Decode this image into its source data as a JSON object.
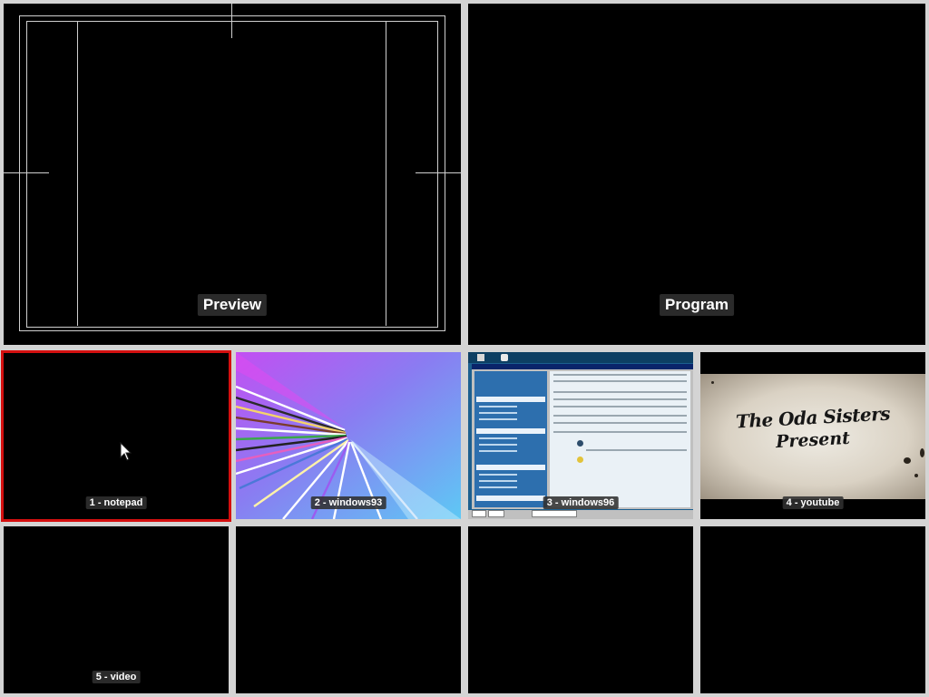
{
  "preview": {
    "label": "Preview"
  },
  "program": {
    "label": "Program"
  },
  "sources": [
    {
      "label": "1 - notepad"
    },
    {
      "label": "2 - windows93"
    },
    {
      "label": "3 - windows96"
    },
    {
      "label": "4 - youtube",
      "thumbnail_text": [
        "The Oda Sisters",
        "Present"
      ]
    },
    {
      "label": "5 - video"
    },
    {
      "label": ""
    },
    {
      "label": ""
    },
    {
      "label": ""
    }
  ],
  "active_source": 1,
  "colors": {
    "background": "#d4d4d4",
    "pane": "#000000",
    "active_border": "#d40f0f",
    "guides": "#cfcfcf"
  }
}
